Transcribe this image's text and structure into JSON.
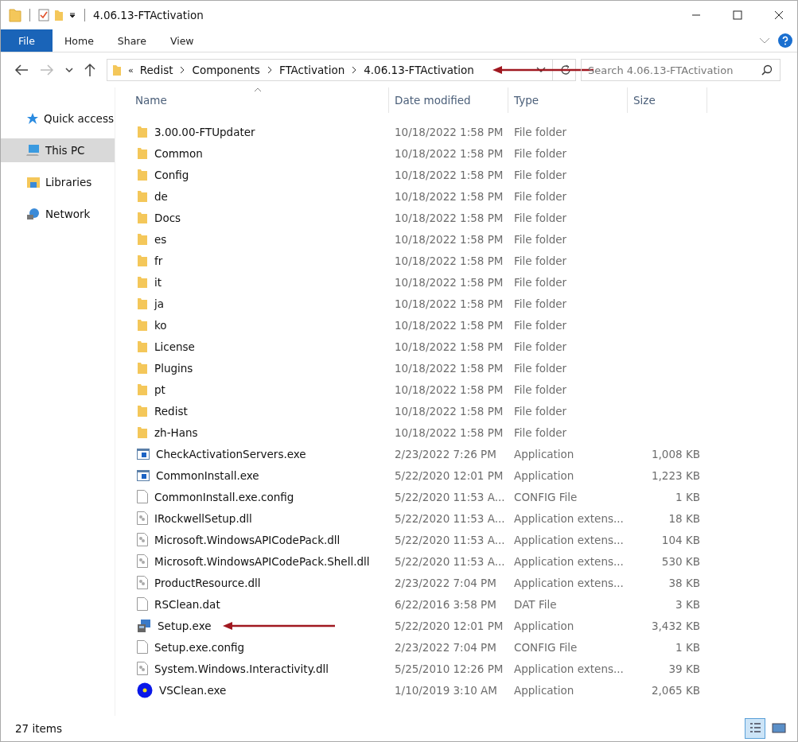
{
  "window": {
    "title": "4.06.13-FTActivation"
  },
  "ribbon_tabs": [
    {
      "label": "File",
      "selected": true
    },
    {
      "label": "Home",
      "selected": false
    },
    {
      "label": "Share",
      "selected": false
    },
    {
      "label": "View",
      "selected": false
    }
  ],
  "address": {
    "crumbs": [
      "«",
      "Redist",
      "Components",
      "FTActivation",
      "4.06.13-FTActivation"
    ],
    "arrow": true
  },
  "search": {
    "placeholder": "Search 4.06.13-FTActivation"
  },
  "sidebar": {
    "items": [
      {
        "label": "Quick access",
        "kind": "star",
        "selected": false
      },
      {
        "label": "This PC",
        "kind": "pc",
        "selected": true
      },
      {
        "label": "Libraries",
        "kind": "library",
        "selected": false
      },
      {
        "label": "Network",
        "kind": "network",
        "selected": false
      }
    ]
  },
  "table": {
    "columns": [
      "Name",
      "Date modified",
      "Type",
      "Size"
    ],
    "rows": [
      {
        "kind": "folder",
        "name": "3.00.00-FTUpdater",
        "date": "10/18/2022 1:58 PM",
        "type": "File folder",
        "size": ""
      },
      {
        "kind": "folder",
        "name": "Common",
        "date": "10/18/2022 1:58 PM",
        "type": "File folder",
        "size": ""
      },
      {
        "kind": "folder",
        "name": "Config",
        "date": "10/18/2022 1:58 PM",
        "type": "File folder",
        "size": ""
      },
      {
        "kind": "folder",
        "name": "de",
        "date": "10/18/2022 1:58 PM",
        "type": "File folder",
        "size": ""
      },
      {
        "kind": "folder",
        "name": "Docs",
        "date": "10/18/2022 1:58 PM",
        "type": "File folder",
        "size": ""
      },
      {
        "kind": "folder",
        "name": "es",
        "date": "10/18/2022 1:58 PM",
        "type": "File folder",
        "size": ""
      },
      {
        "kind": "folder",
        "name": "fr",
        "date": "10/18/2022 1:58 PM",
        "type": "File folder",
        "size": ""
      },
      {
        "kind": "folder",
        "name": "it",
        "date": "10/18/2022 1:58 PM",
        "type": "File folder",
        "size": ""
      },
      {
        "kind": "folder",
        "name": "ja",
        "date": "10/18/2022 1:58 PM",
        "type": "File folder",
        "size": ""
      },
      {
        "kind": "folder",
        "name": "ko",
        "date": "10/18/2022 1:58 PM",
        "type": "File folder",
        "size": ""
      },
      {
        "kind": "folder",
        "name": "License",
        "date": "10/18/2022 1:58 PM",
        "type": "File folder",
        "size": ""
      },
      {
        "kind": "folder",
        "name": "Plugins",
        "date": "10/18/2022 1:58 PM",
        "type": "File folder",
        "size": ""
      },
      {
        "kind": "folder",
        "name": "pt",
        "date": "10/18/2022 1:58 PM",
        "type": "File folder",
        "size": ""
      },
      {
        "kind": "folder",
        "name": "Redist",
        "date": "10/18/2022 1:58 PM",
        "type": "File folder",
        "size": ""
      },
      {
        "kind": "folder",
        "name": "zh-Hans",
        "date": "10/18/2022 1:58 PM",
        "type": "File folder",
        "size": ""
      },
      {
        "kind": "app",
        "name": "CheckActivationServers.exe",
        "date": "2/23/2022 7:26 PM",
        "type": "Application",
        "size": "1,008 KB"
      },
      {
        "kind": "app",
        "name": "CommonInstall.exe",
        "date": "5/22/2020 12:01 PM",
        "type": "Application",
        "size": "1,223 KB"
      },
      {
        "kind": "file",
        "name": "CommonInstall.exe.config",
        "date": "5/22/2020 11:53 A...",
        "type": "CONFIG File",
        "size": "1 KB"
      },
      {
        "kind": "dll",
        "name": "IRockwellSetup.dll",
        "date": "5/22/2020 11:53 A...",
        "type": "Application extens...",
        "size": "18 KB"
      },
      {
        "kind": "dll",
        "name": "Microsoft.WindowsAPICodePack.dll",
        "date": "5/22/2020 11:53 A...",
        "type": "Application extens...",
        "size": "104 KB"
      },
      {
        "kind": "dll",
        "name": "Microsoft.WindowsAPICodePack.Shell.dll",
        "date": "5/22/2020 11:53 A...",
        "type": "Application extens...",
        "size": "530 KB"
      },
      {
        "kind": "dll",
        "name": "ProductResource.dll",
        "date": "2/23/2022 7:04 PM",
        "type": "Application extens...",
        "size": "38 KB"
      },
      {
        "kind": "file",
        "name": "RSClean.dat",
        "date": "6/22/2016 3:58 PM",
        "type": "DAT File",
        "size": "3 KB"
      },
      {
        "kind": "installer",
        "name": "Setup.exe",
        "date": "5/22/2020 12:01 PM",
        "type": "Application",
        "size": "3,432 KB",
        "arrow": true
      },
      {
        "kind": "file",
        "name": "Setup.exe.config",
        "date": "2/23/2022 7:04 PM",
        "type": "CONFIG File",
        "size": "1 KB"
      },
      {
        "kind": "dll",
        "name": "System.Windows.Interactivity.dll",
        "date": "5/25/2010 12:26 PM",
        "type": "Application extens...",
        "size": "39 KB"
      },
      {
        "kind": "disc",
        "name": "VSClean.exe",
        "date": "1/10/2019 3:10 AM",
        "type": "Application",
        "size": "2,065 KB"
      }
    ]
  },
  "status_bar": {
    "count": "27 items",
    "views": [
      {
        "kind": "details",
        "selected": true
      },
      {
        "kind": "tiles",
        "selected": false
      }
    ]
  }
}
